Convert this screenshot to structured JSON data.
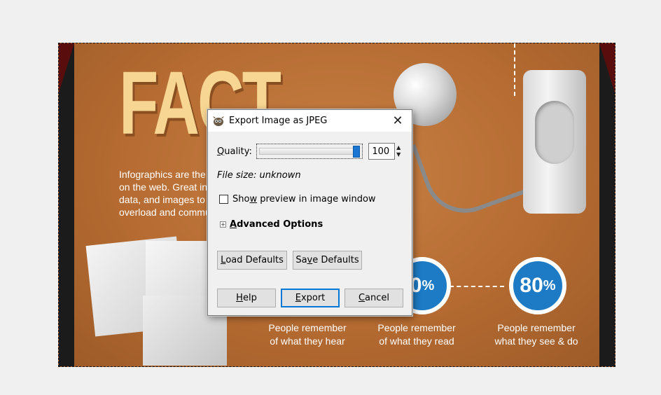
{
  "background_image": {
    "fact_title": "FACT",
    "intro_lines": [
      "Infographics are the ul",
      "on the web. Great info",
      "data, and images to ov",
      "overload and commun"
    ],
    "stat_partial_value": "0",
    "stat_partial_unit": "%",
    "stat_main_value": "80",
    "stat_main_unit": "%",
    "captions": {
      "hear": [
        "People remember",
        "of what they hear"
      ],
      "read": [
        "People remember",
        "of what they read"
      ],
      "see": [
        "People remember",
        "what they see & do"
      ]
    },
    "colors": {
      "background": "#b86f34",
      "title": "#f7d592",
      "circle": "#1d7ac4"
    }
  },
  "dialog": {
    "title": "Export Image as JPEG",
    "app_icon": "gimp-icon",
    "close_glyph": "✕",
    "quality": {
      "label_prefix": "Q",
      "label_rest": "uality:",
      "value": "100",
      "slider_fraction": 1.0
    },
    "file_size": "File size: unknown",
    "preview": {
      "label_pre": "Sho",
      "label_u": "w",
      "label_post": " preview in image window",
      "checked": false
    },
    "advanced": {
      "expander": "+",
      "label_u": "A",
      "label_rest": "dvanced Options"
    },
    "buttons": {
      "load_defaults": {
        "u": "L",
        "rest": "oad Defaults"
      },
      "save_defaults": {
        "pre": "Sa",
        "u": "v",
        "rest": "e Defaults"
      },
      "help": {
        "u": "H",
        "rest": "elp"
      },
      "export": {
        "u": "E",
        "rest": "xport"
      },
      "cancel": {
        "u": "C",
        "rest": "ancel"
      }
    }
  }
}
